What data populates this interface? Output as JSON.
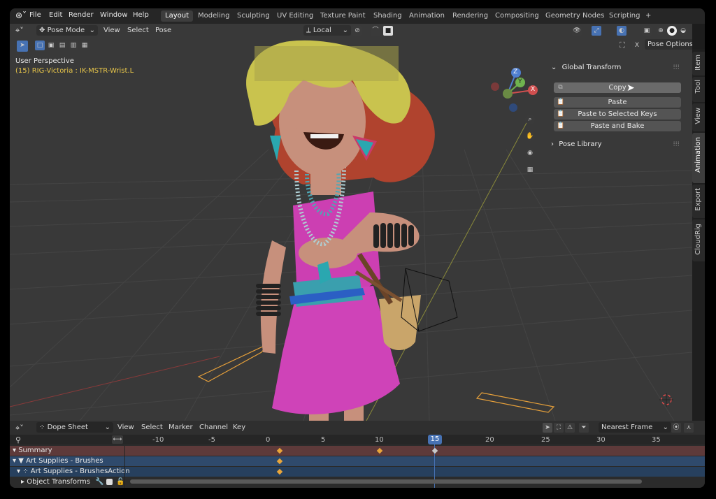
{
  "topbar": {
    "menus": [
      "File",
      "Edit",
      "Render",
      "Window",
      "Help"
    ],
    "workspace_tabs": [
      "Layout",
      "Modeling",
      "Sculpting",
      "UV Editing",
      "Texture Paint",
      "Shading",
      "Animation",
      "Rendering",
      "Compositing",
      "Geometry Nodes",
      "Scripting"
    ],
    "active_tab": "Layout",
    "add_tab": "+"
  },
  "viewport": {
    "mode": "Pose Mode",
    "menus": [
      "View",
      "Select",
      "Pose"
    ],
    "orientation": "Local",
    "pose_options": "Pose Options",
    "perspective": "User Perspective",
    "object_info": "(15) RIG-Victoria : IK-MSTR-Wrist.L",
    "close": "X",
    "gizmo": {
      "z": "Z",
      "y": "Y",
      "x": "X"
    }
  },
  "npanel": {
    "section_title": "Global Transform",
    "buttons": [
      "Copy",
      "Paste",
      "Paste to Selected Keys",
      "Paste and Bake"
    ],
    "pose_library": "Pose Library",
    "tabs": [
      "Item",
      "Tool",
      "View",
      "Animation",
      "Export",
      "CloudRig"
    ]
  },
  "dopesheet": {
    "editor": "Dope Sheet",
    "menus": [
      "View",
      "Select",
      "Marker",
      "Channel",
      "Key"
    ],
    "snapping": "Nearest Frame",
    "current_frame": "15",
    "ticks": [
      "-10",
      "-5",
      "0",
      "5",
      "10",
      "20",
      "25",
      "30",
      "35"
    ],
    "channels": [
      "Summary",
      "Art Supplies - Brushes",
      "Art Supplies - BrushesAction",
      "Object Transforms"
    ]
  },
  "colors": {
    "accent": "#4772b3",
    "keyframe": "#e9a53a",
    "summary_row": "#5e3a3a",
    "object_row": "#2f4a6c"
  }
}
